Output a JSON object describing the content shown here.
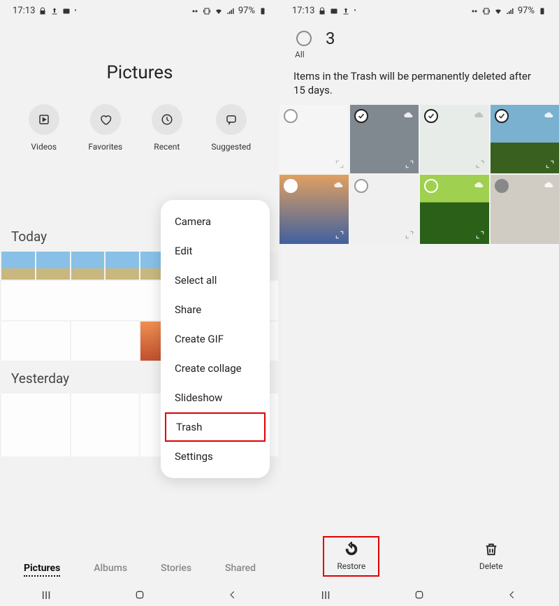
{
  "status": {
    "time": "17:13",
    "battery": "97%"
  },
  "left": {
    "title": "Pictures",
    "shortcuts": {
      "videos": "Videos",
      "favorites": "Favorites",
      "recent": "Recent",
      "suggested": "Suggested"
    },
    "sections": {
      "today": "Today",
      "yesterday": "Yesterday"
    },
    "tabs": {
      "pictures": "Pictures",
      "albums": "Albums",
      "stories": "Stories",
      "shared": "Shared"
    },
    "menu": {
      "camera": "Camera",
      "edit": "Edit",
      "select_all": "Select all",
      "share": "Share",
      "create_gif": "Create GIF",
      "create_collage": "Create collage",
      "slideshow": "Slideshow",
      "trash": "Trash",
      "settings": "Settings"
    }
  },
  "right": {
    "select_count": "3",
    "select_all": "All",
    "message": "Items in the Trash will be permanently deleted after 15 days.",
    "actions": {
      "restore": "Restore",
      "delete": "Delete"
    }
  }
}
